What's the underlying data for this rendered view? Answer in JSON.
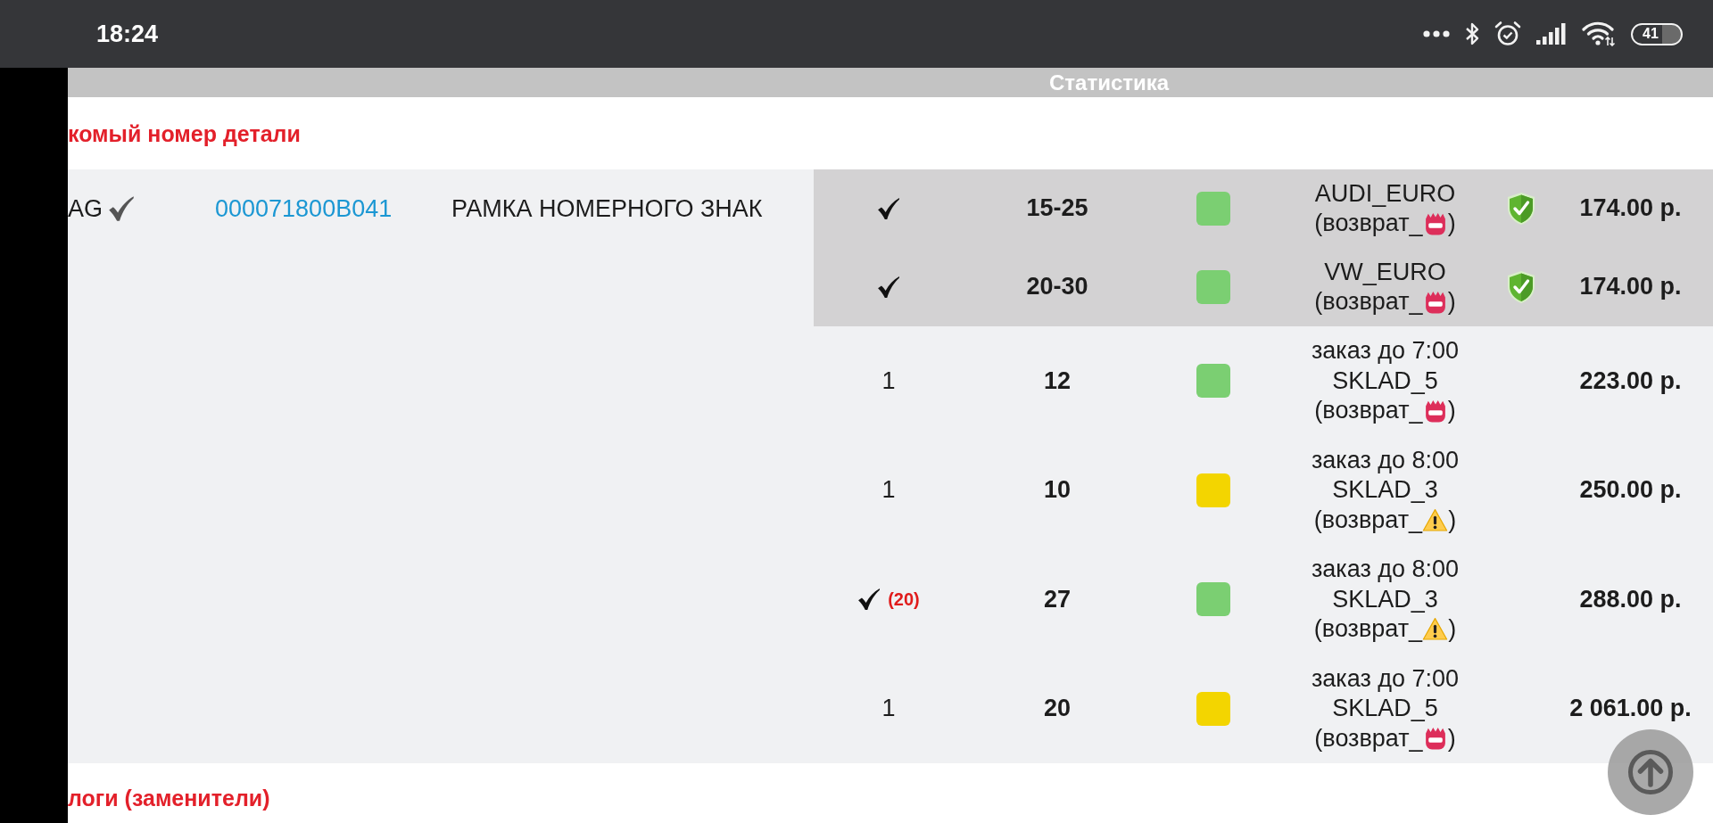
{
  "status_bar": {
    "time": "18:24",
    "battery": "41"
  },
  "table_header": {
    "label": "Статистика"
  },
  "searched_part": {
    "title": "комый номер детали",
    "brand": "AG",
    "brand_checked": true,
    "part_number": "000071800B041",
    "description": "РАМКА НОМЕРНОГО ЗНАК",
    "offers": [
      {
        "highlighted": true,
        "in_stock": true,
        "days": "15-25",
        "color": "#7bcf72",
        "warehouse": "AUDI_EURO",
        "return_prefix": "(возврат_",
        "return_icon": {
          "kind": "badge"
        },
        "return_suffix": ")",
        "verified": true,
        "price": "174.00 р."
      },
      {
        "highlighted": true,
        "in_stock": true,
        "days": "20-30",
        "color": "#7bcf72",
        "warehouse": "VW_EURO",
        "return_prefix": "(возврат_",
        "return_icon": {
          "kind": "badge"
        },
        "return_suffix": ")",
        "verified": true,
        "price": "174.00 р."
      },
      {
        "highlighted": false,
        "in_stock": false,
        "quantity": "1",
        "days": "12",
        "color": "#7bcf72",
        "order_deadline": "заказ до 7:00",
        "warehouse": "SKLAD_5",
        "return_prefix": "(возврат_",
        "return_icon": {
          "kind": "badge"
        },
        "return_suffix": ")",
        "verified": false,
        "price": "223.00 р."
      },
      {
        "highlighted": false,
        "in_stock": false,
        "quantity": "1",
        "days": "10",
        "color": "#f3d500",
        "order_deadline": "заказ до 8:00",
        "warehouse": "SKLAD_3",
        "return_prefix": "(возврат_",
        "return_icon": {
          "kind": "warning"
        },
        "return_suffix": ")",
        "verified": false,
        "price": "250.00 р."
      },
      {
        "highlighted": false,
        "in_stock": true,
        "quantity_note": "(20)",
        "days": "27",
        "color": "#7bcf72",
        "order_deadline": "заказ до 8:00",
        "warehouse": "SKLAD_3",
        "return_prefix": "(возврат_",
        "return_icon": {
          "kind": "warning"
        },
        "return_suffix": ")",
        "verified": false,
        "price": "288.00 р."
      },
      {
        "highlighted": false,
        "in_stock": false,
        "quantity": "1",
        "days": "20",
        "color": "#f3d500",
        "order_deadline": "заказ до 7:00",
        "warehouse": "SKLAD_5",
        "return_prefix": "(возврат_",
        "return_icon": {
          "kind": "badge"
        },
        "return_suffix": ")",
        "verified": false,
        "price": "2 061.00 р."
      }
    ]
  },
  "analogs": {
    "title": "логи (заменители)"
  }
}
